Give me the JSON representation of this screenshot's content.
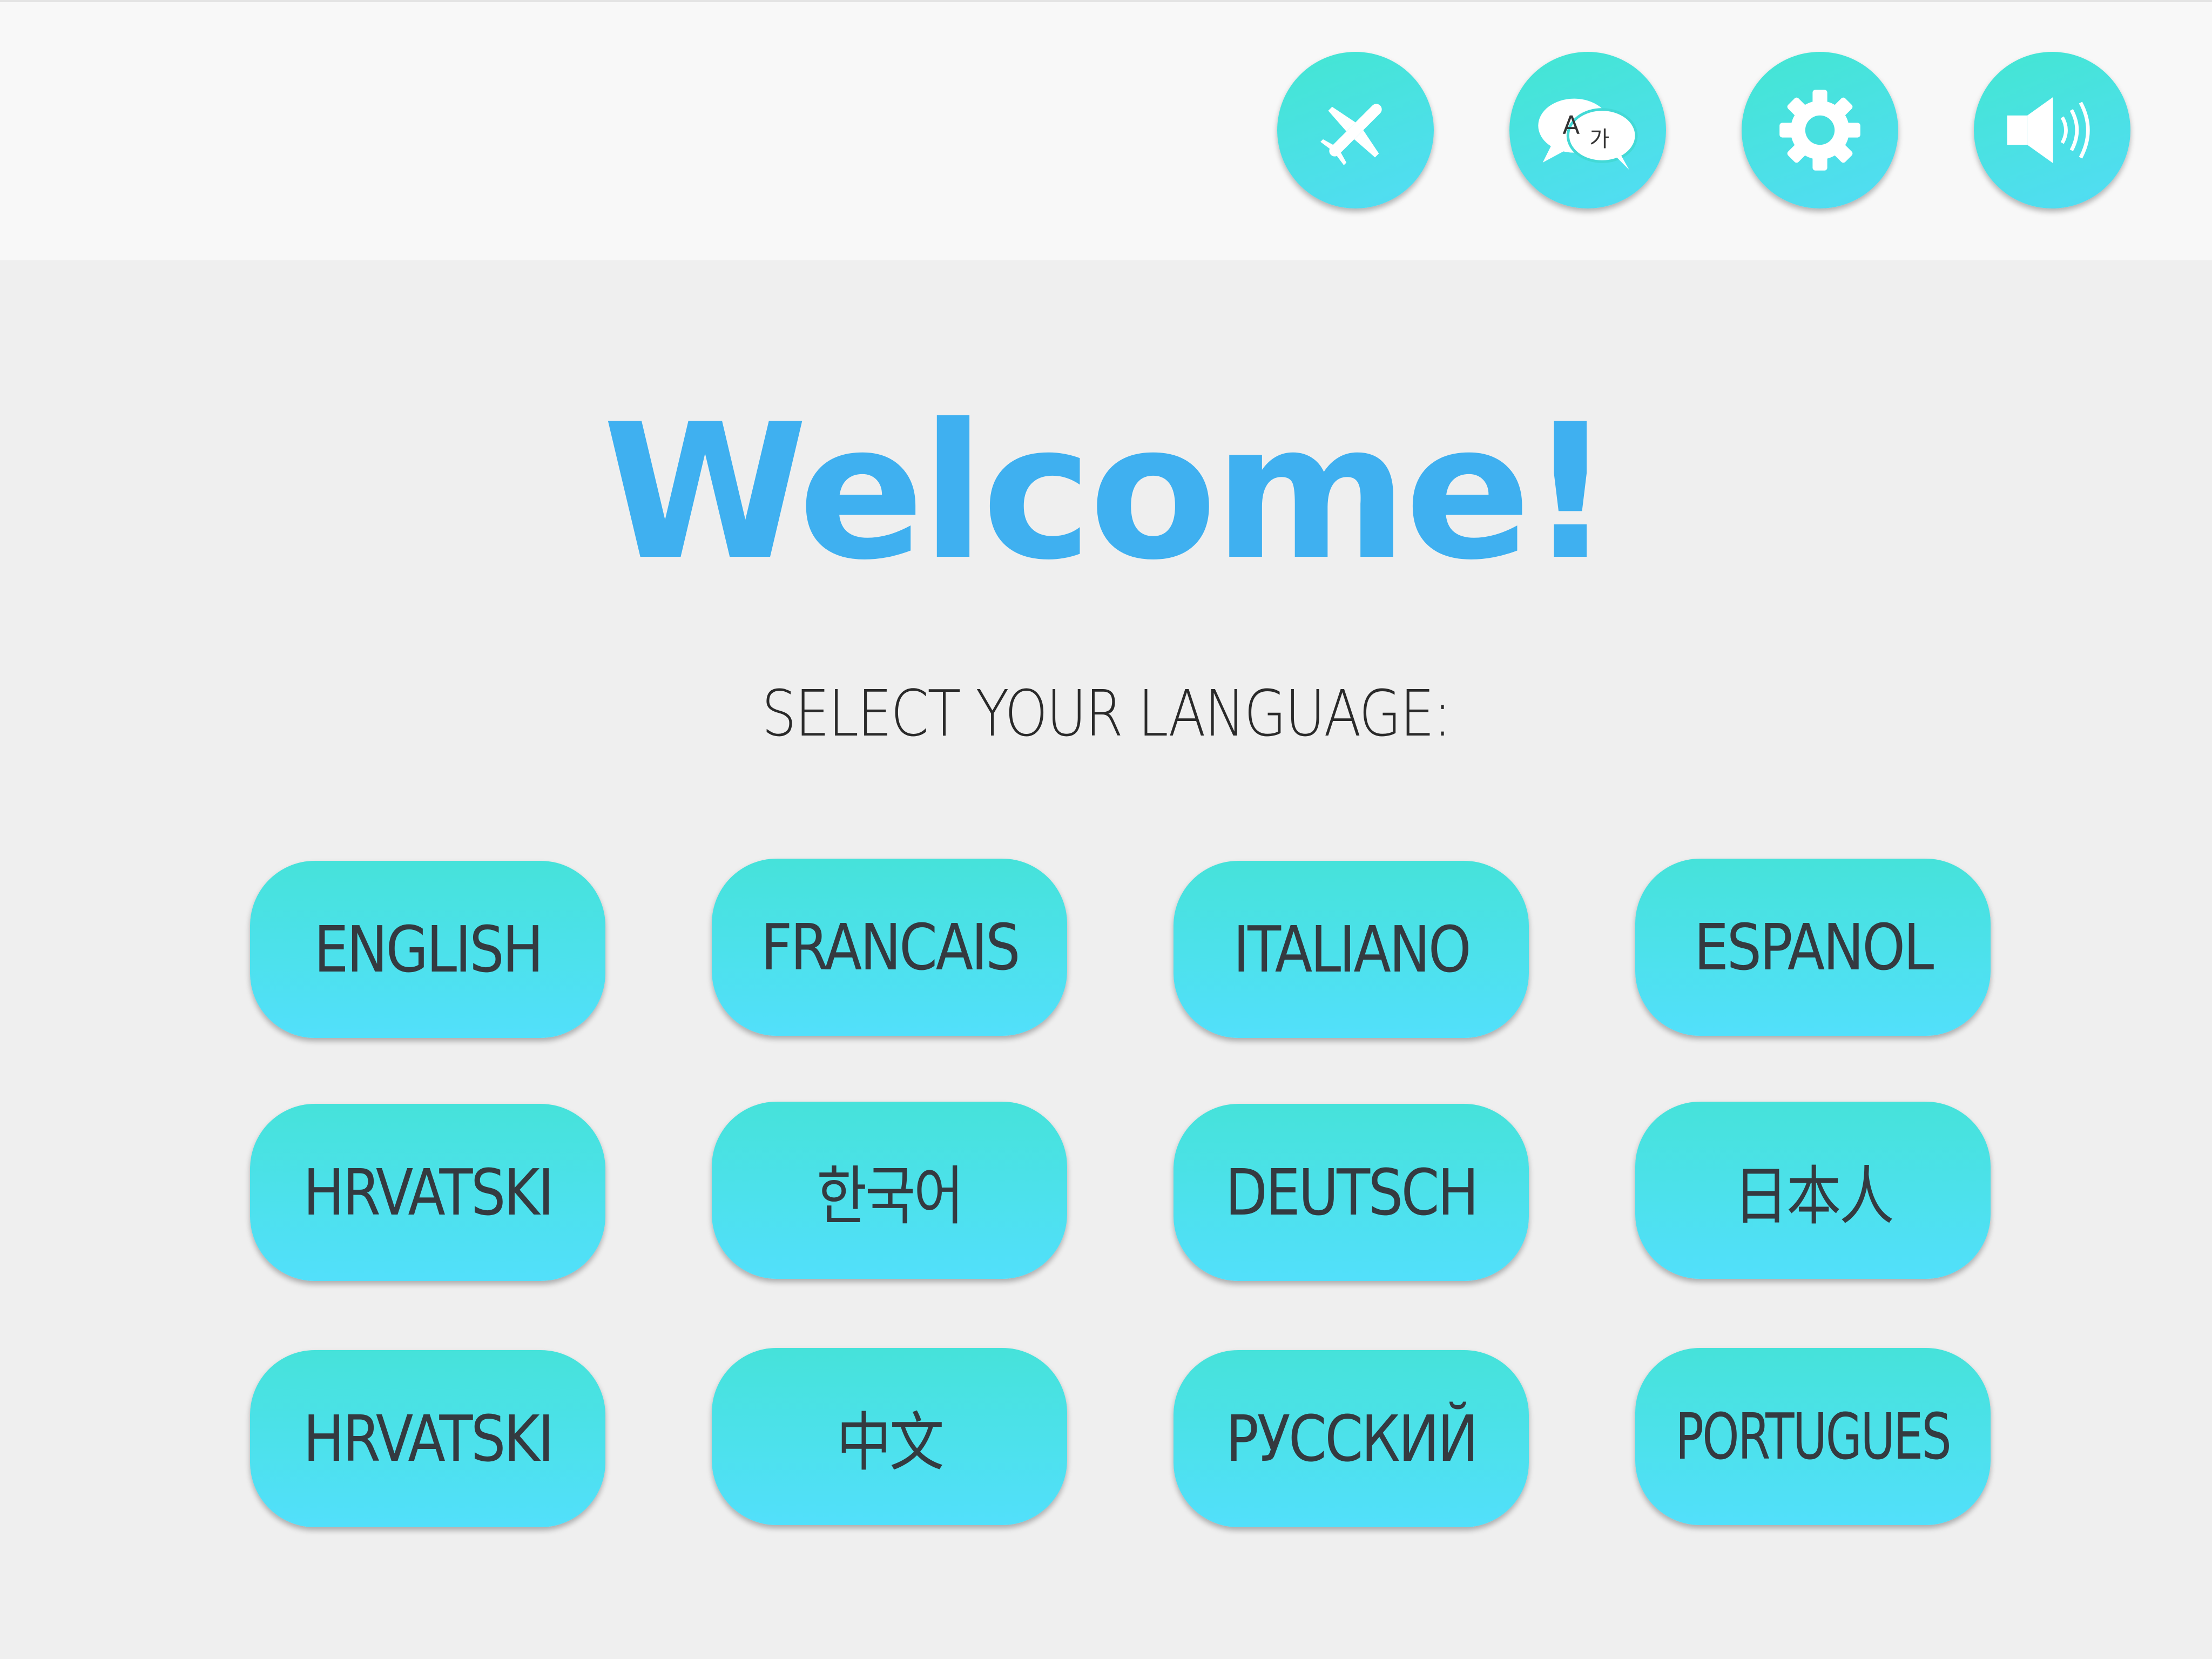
{
  "toolbar": {
    "icons": [
      {
        "name": "airplane-icon"
      },
      {
        "name": "translate-icon",
        "glyph_a": "A",
        "glyph_b": "가"
      },
      {
        "name": "gear-icon"
      },
      {
        "name": "speaker-icon"
      }
    ]
  },
  "main": {
    "title": "Welcome!",
    "subtitle": "SELECT YOUR LANGUAGE:",
    "languages": [
      "ENGLISH",
      "FRANCAIS",
      "ITALIANO",
      "ESPANOL",
      "HRVATSKI",
      "한국어",
      "DEUTSCH",
      "日本人",
      "HRVATSKI",
      "中文",
      "РУССКИЙ",
      "PORTUGUES"
    ]
  },
  "colors": {
    "accent_gradient_start": "#43e6d2",
    "accent_gradient_end": "#52dcf5",
    "title": "#3fb0f0",
    "button_text": "#343a40",
    "background": "#efefef",
    "topbar": "#f8f8f8"
  }
}
